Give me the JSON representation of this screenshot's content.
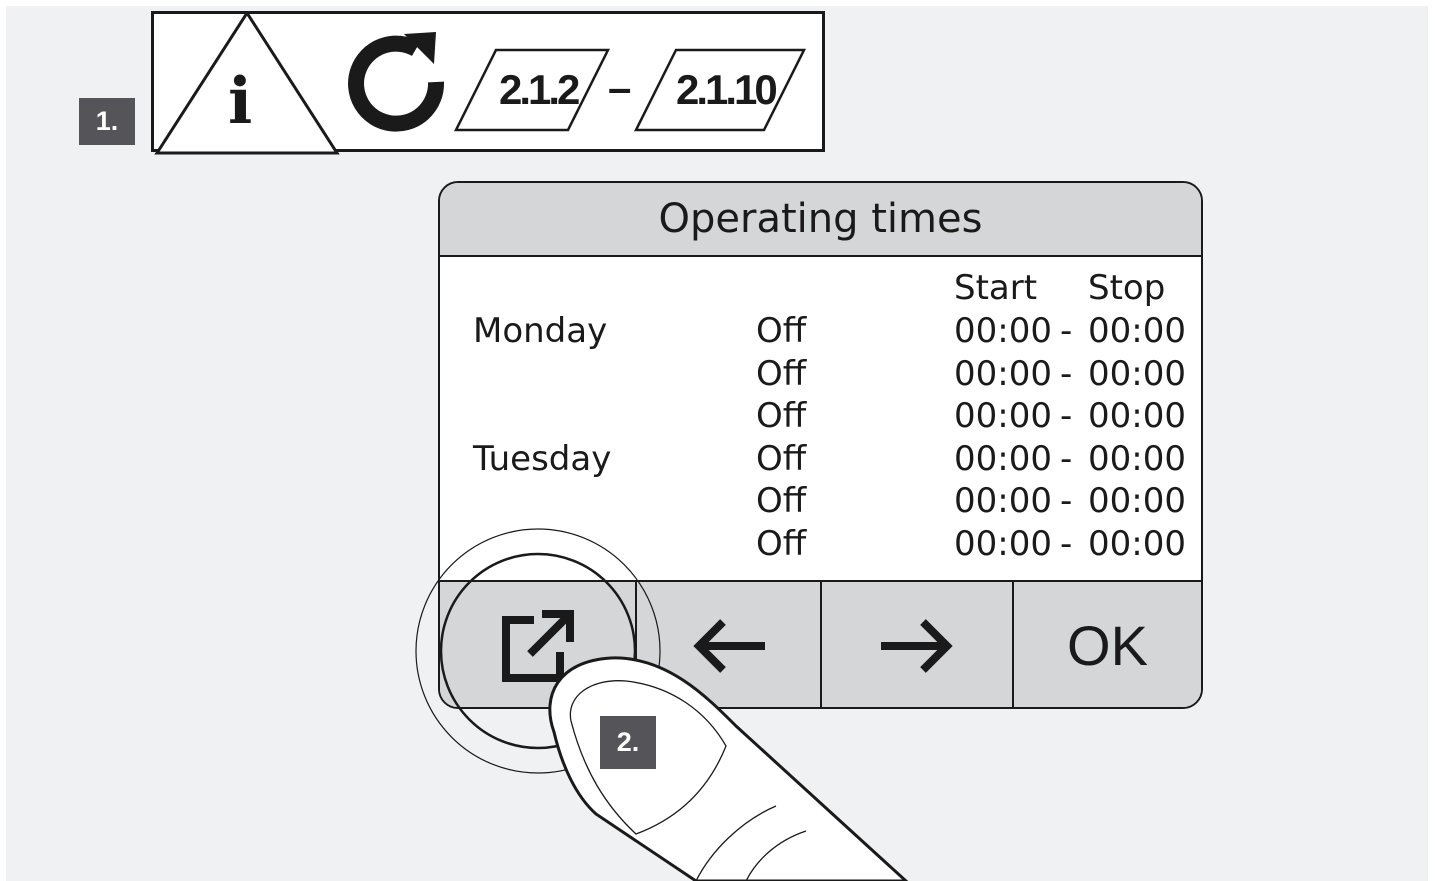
{
  "steps": {
    "step1": "1.",
    "step2": "2."
  },
  "banner": {
    "info_symbol": "i",
    "param_start": "2.1.2",
    "dash": "–",
    "param_end": "2.1.10"
  },
  "screen": {
    "title": "Operating times",
    "headers": {
      "start": "Start",
      "stop": "Stop"
    },
    "rows": [
      {
        "day": "Monday",
        "state": "Off",
        "start": "00:00",
        "sep": "-",
        "stop": "00:00"
      },
      {
        "day": "",
        "state": "Off",
        "start": "00:00",
        "sep": "-",
        "stop": "00:00"
      },
      {
        "day": "",
        "state": "Off",
        "start": "00:00",
        "sep": "-",
        "stop": "00:00"
      },
      {
        "day": "Tuesday",
        "state": "Off",
        "start": "00:00",
        "sep": "-",
        "stop": "00:00"
      },
      {
        "day": "",
        "state": "Off",
        "start": "00:00",
        "sep": "-",
        "stop": "00:00"
      },
      {
        "day": "",
        "state": "Off",
        "start": "00:00",
        "sep": "-",
        "stop": "00:00"
      }
    ],
    "buttons": {
      "edit_icon": "edit-external-icon",
      "left_icon": "arrow-left-icon",
      "right_icon": "arrow-right-icon",
      "ok_label": "OK"
    }
  },
  "colors": {
    "ink": "#1a1a1a",
    "bar": "#d5d6d8",
    "badge": "#555559",
    "background": "#f0f1f3"
  }
}
